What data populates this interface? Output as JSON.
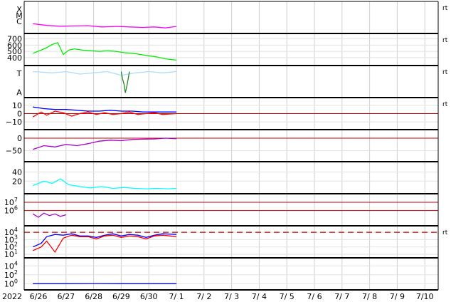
{
  "chart_data": {
    "type": "line",
    "x_axis": {
      "year_label": "2022",
      "ticks": [
        "6/26",
        "6/27",
        "6/28",
        "6/29",
        "6/30",
        "7/ 1",
        "7/ 2",
        "7/ 3",
        "7/ 4",
        "7/ 5",
        "7/ 6",
        "7/ 7",
        "7/ 8",
        "7/ 9",
        "7/10"
      ],
      "data_start_day": -0.2,
      "data_end_day": 5.0,
      "grid": true
    },
    "panels": [
      {
        "id": "xmc",
        "y_labels": [
          "X",
          "M",
          "C"
        ],
        "side_label": "rt",
        "series": [
          {
            "color": "#ff00ff",
            "x": [
              -0.2,
              0.3,
              0.8,
              1.3,
              1.8,
              2.3,
              2.8,
              3.3,
              3.8,
              4.2,
              4.6,
              5.0
            ],
            "y": [
              0.25,
              0.18,
              0.15,
              0.16,
              0.17,
              0.12,
              0.14,
              0.12,
              0.1,
              0.12,
              0.08,
              0.14
            ]
          }
        ]
      },
      {
        "id": "wind_speed",
        "y_ticks": [
          "700",
          "600",
          "500",
          "400"
        ],
        "y_values": [
          700,
          600,
          500,
          400
        ],
        "ylim": [
          330,
          730
        ],
        "side_label": "rt",
        "series": [
          {
            "color": "#00ee00",
            "x": [
              -0.2,
              0.1,
              0.3,
              0.5,
              0.7,
              0.9,
              1.1,
              1.3,
              1.6,
              1.9,
              2.2,
              2.5,
              2.8,
              3.1,
              3.4,
              3.7,
              4.0,
              4.3,
              4.6,
              5.0
            ],
            "y": [
              470,
              520,
              560,
              610,
              640,
              450,
              520,
              540,
              520,
              510,
              500,
              510,
              500,
              480,
              470,
              450,
              430,
              410,
              380,
              360
            ]
          }
        ]
      },
      {
        "id": "ta",
        "y_labels": [
          "T",
          "A"
        ],
        "side_label": "rt",
        "series": [
          {
            "color": "#aaddff",
            "x": [
              -0.2,
              0.5,
              1.0,
              1.5,
              2.0,
              2.5,
              3.0,
              3.5,
              4.0,
              4.5,
              5.0
            ],
            "y": [
              0.9,
              0.85,
              0.9,
              0.8,
              0.85,
              0.9,
              0.75,
              0.85,
              0.9,
              0.85,
              0.9
            ]
          },
          {
            "color": "#228822",
            "x": [
              3.0,
              3.05,
              3.1,
              3.15,
              3.2,
              3.25,
              3.3
            ],
            "y": [
              0.9,
              0.6,
              0.4,
              0.05,
              0.3,
              0.6,
              0.9
            ]
          }
        ]
      },
      {
        "id": "magnetic_field",
        "y_ticks": [
          "10",
          "0",
          "−10"
        ],
        "y_values": [
          10,
          0,
          -10
        ],
        "ylim": [
          -15,
          15
        ],
        "zero_line": 0,
        "side_label": "rt",
        "series": [
          {
            "color": "#0000ff",
            "x": [
              -0.2,
              0.2,
              0.6,
              1.0,
              1.4,
              1.8,
              2.2,
              2.6,
              3.0,
              3.4,
              3.8,
              4.2,
              4.6,
              5.0
            ],
            "y": [
              8,
              6,
              5,
              5,
              4,
              3,
              3,
              4,
              3,
              3,
              2,
              2,
              2,
              2
            ]
          },
          {
            "color": "#ff0000",
            "x": [
              -0.2,
              0.1,
              0.3,
              0.6,
              0.9,
              1.2,
              1.5,
              1.8,
              2.1,
              2.4,
              2.7,
              3.0,
              3.3,
              3.6,
              3.9,
              4.2,
              4.5,
              5.0
            ],
            "y": [
              -4,
              2,
              -2,
              3,
              1,
              -3,
              0,
              2,
              -1,
              1,
              -1,
              0,
              2,
              -1,
              0,
              1,
              -1,
              0
            ]
          }
        ]
      },
      {
        "id": "dst",
        "y_ticks": [
          "0",
          "−50"
        ],
        "y_values": [
          0,
          -50
        ],
        "ylim": [
          -80,
          20
        ],
        "zero_line": 0,
        "series": [
          {
            "color": "#aa00cc",
            "x": [
              -0.2,
              0.2,
              0.6,
              1.0,
              1.4,
              1.8,
              2.2,
              2.6,
              3.0,
              3.4,
              3.8,
              4.2,
              4.6,
              5.0
            ],
            "y": [
              -45,
              -30,
              -35,
              -25,
              -30,
              -22,
              -12,
              -8,
              -10,
              -5,
              -4,
              -3,
              0,
              -2
            ]
          }
        ]
      },
      {
        "id": "ae",
        "y_ticks": [
          "40",
          "20"
        ],
        "y_values": [
          40,
          20
        ],
        "ylim": [
          0,
          55
        ],
        "series": [
          {
            "color": "#00ffff",
            "x": [
              -0.2,
              0.2,
              0.5,
              0.8,
              1.1,
              1.5,
              1.9,
              2.3,
              2.7,
              3.1,
              3.5,
              3.9,
              4.3,
              4.7,
              5.0
            ],
            "y": [
              10,
              20,
              15,
              25,
              12,
              8,
              5,
              8,
              4,
              6,
              4,
              3,
              4,
              3,
              4
            ]
          }
        ]
      },
      {
        "id": "electron_flux",
        "y_ticks": [
          "10^7",
          "10^6"
        ],
        "y_values": [
          7,
          6
        ],
        "ylim": [
          4.6,
          7.6
        ],
        "ref_lines": [
          7,
          6
        ],
        "series": [
          {
            "color": "#aa00cc",
            "x": [
              -0.2,
              0.0,
              0.2,
              0.4,
              0.6,
              0.8,
              1.0
            ],
            "y": [
              5.6,
              5.2,
              5.7,
              5.4,
              5.6,
              5.3,
              5.5
            ]
          }
        ]
      },
      {
        "id": "proton_flux",
        "y_ticks": [
          "10^4",
          "10^3",
          "10^2",
          "10^1"
        ],
        "y_values": [
          4,
          3,
          2,
          1
        ],
        "ylim": [
          1,
          4.4
        ],
        "dashed_line": 4,
        "side_label": "rt",
        "series": [
          {
            "color": "#0000ff",
            "x": [
              -0.2,
              0.1,
              0.3,
              0.6,
              0.9,
              1.2,
              1.5,
              1.8,
              2.1,
              2.4,
              2.7,
              3.0,
              3.3,
              3.6,
              3.9,
              4.2,
              4.5,
              5.0
            ],
            "y": [
              2.0,
              2.5,
              3.4,
              3.7,
              3.6,
              3.8,
              3.5,
              3.5,
              3.3,
              3.6,
              3.8,
              3.5,
              3.7,
              3.6,
              3.3,
              3.6,
              3.8,
              3.7
            ]
          },
          {
            "color": "#ff0000",
            "x": [
              -0.2,
              0.1,
              0.3,
              0.6,
              0.9,
              1.2,
              1.5,
              1.8,
              2.1,
              2.4,
              2.7,
              3.0,
              3.3,
              3.6,
              3.9,
              4.2,
              4.5,
              5.0
            ],
            "y": [
              1.5,
              2.0,
              2.8,
              1.3,
              3.2,
              3.6,
              3.4,
              3.4,
              3.1,
              3.5,
              3.6,
              3.3,
              3.5,
              3.4,
              3.1,
              3.5,
              3.6,
              3.4
            ]
          }
        ]
      },
      {
        "id": "xray_flux",
        "y_ticks": [
          "10^4",
          "10^2",
          "10^0"
        ],
        "y_values": [
          4,
          2,
          0
        ],
        "ylim": [
          -0.6,
          5
        ],
        "series": [
          {
            "color": "#0000ff",
            "x": [
              -0.2,
              1.0,
              2.0,
              3.0,
              4.0,
              5.0
            ],
            "y": [
              0.0,
              0.0,
              0.02,
              0.0,
              0.0,
              0.0
            ]
          }
        ]
      }
    ]
  }
}
